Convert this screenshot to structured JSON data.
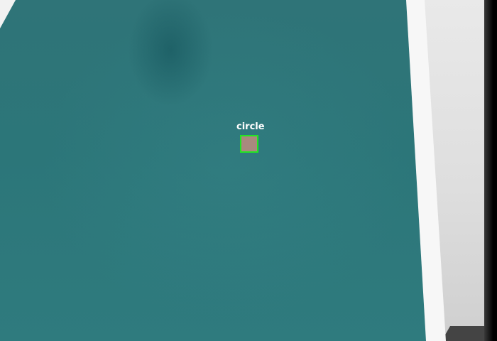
{
  "image": {
    "description_type": "camera-frame-with-detection-overlay"
  },
  "detections": [
    {
      "label": "circle",
      "box_color": "#22e622"
    }
  ],
  "colors": {
    "board": "#2e777a",
    "board_edge": "#f7f7f7",
    "box": "#22e622",
    "label_text": "#ffffff"
  }
}
